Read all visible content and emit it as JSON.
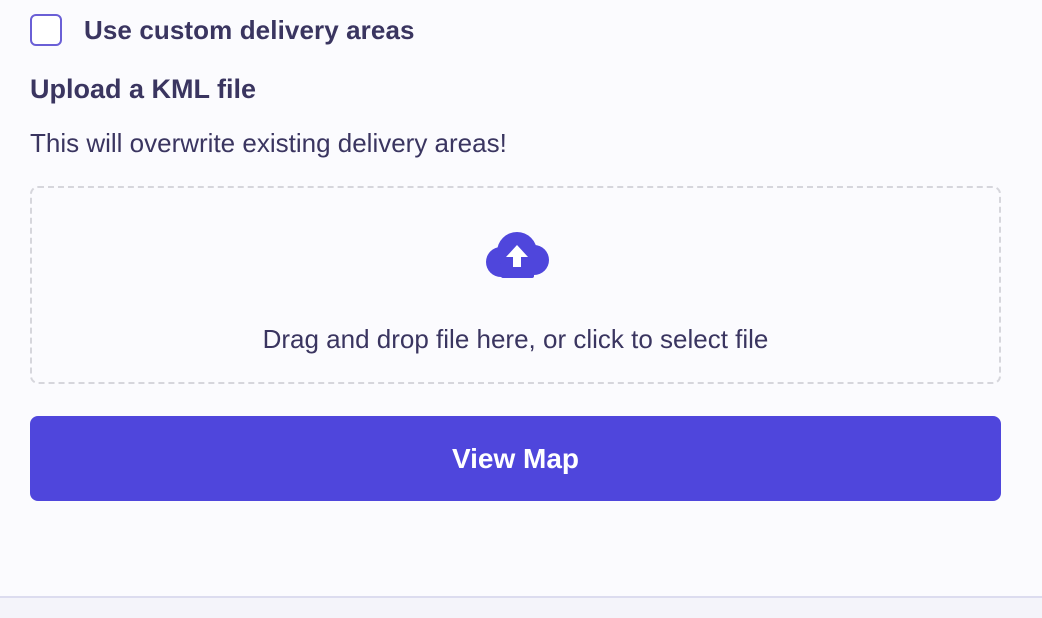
{
  "custom_areas": {
    "label": "Use custom delivery areas",
    "checked": false
  },
  "upload": {
    "heading": "Upload a KML file",
    "warning": "This will overwrite existing delivery areas!",
    "dropzone_text": "Drag and drop file here, or click to select file",
    "icon": "cloud-upload-icon"
  },
  "actions": {
    "view_map_label": "View Map"
  },
  "colors": {
    "accent": "#4f46dc",
    "text": "#3a3560",
    "background": "#fbfbfe",
    "dropzone_border": "#d6d6dc"
  }
}
